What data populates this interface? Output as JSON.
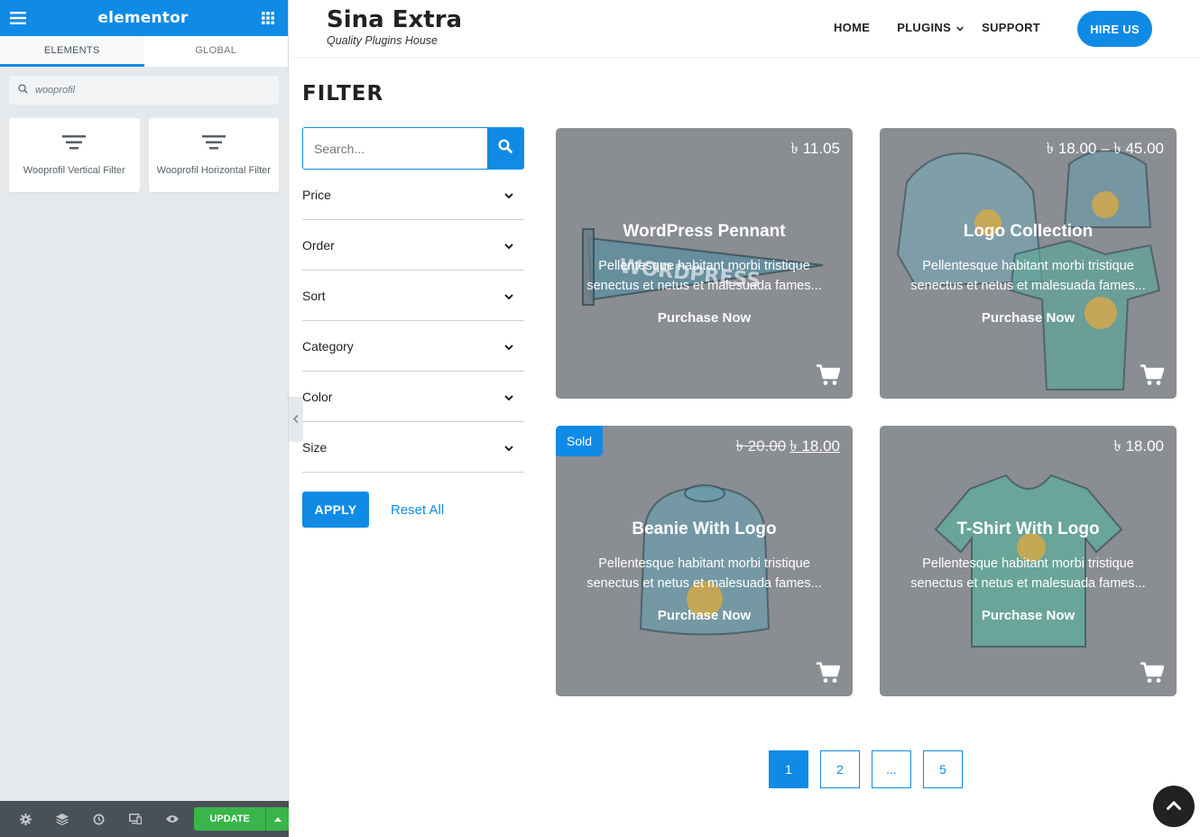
{
  "colors": {
    "accent": "#0f8be6",
    "update_green": "#39b54a",
    "card_bg": "#8a8d91",
    "sidebar_bg": "#e6e9ec"
  },
  "elementor": {
    "brand": "elementor",
    "tabs": [
      {
        "label": "ELEMENTS"
      },
      {
        "label": "GLOBAL"
      }
    ],
    "search": {
      "value": "wooprofil"
    },
    "widgets": [
      {
        "label": "Wooprofil Vertical Filter",
        "icon": "filter-lines-icon"
      },
      {
        "label": "Wooprofil Horizontal Filter",
        "icon": "filter-lines-icon"
      }
    ],
    "footer": {
      "update_label": "UPDATE"
    }
  },
  "site": {
    "title": "Sina Extra",
    "tagline": "Quality Plugins House",
    "nav": [
      {
        "label": "HOME"
      },
      {
        "label": "PLUGINS"
      },
      {
        "label": "SUPPORT"
      }
    ],
    "hire_label": "HIRE US"
  },
  "filter": {
    "heading": "FILTER",
    "search_placeholder": "Search...",
    "facets": [
      {
        "label": "Price"
      },
      {
        "label": "Order"
      },
      {
        "label": "Sort"
      },
      {
        "label": "Category"
      },
      {
        "label": "Color"
      },
      {
        "label": "Size"
      }
    ],
    "apply_label": "APPLY",
    "reset_label": "Reset All"
  },
  "products": [
    {
      "name": "WordPress Pennant",
      "price": "৳ 11.05",
      "desc": "Pellentesque habitant morbi tristique senectus et netus et malesuada fames...",
      "cta": "Purchase Now"
    },
    {
      "name": "Logo Collection",
      "price": "৳ 18.00 – ৳ 45.00",
      "desc": "Pellentesque habitant morbi tristique senectus et netus et malesuada fames...",
      "cta": "Purchase Now"
    },
    {
      "name": "Beanie With Logo",
      "badge": "Sold",
      "old_price": "৳ 20.00",
      "price": "৳ 18.00",
      "desc": "Pellentesque habitant morbi tristique senectus et netus et malesuada fames...",
      "cta": "Purchase Now"
    },
    {
      "name": "T-Shirt With Logo",
      "price": "৳ 18.00",
      "desc": "Pellentesque habitant morbi tristique senectus et netus et malesuada fames...",
      "cta": "Purchase Now"
    }
  ],
  "pagination": [
    {
      "label": "1",
      "current": true
    },
    {
      "label": "2"
    },
    {
      "label": "..."
    },
    {
      "label": "5"
    }
  ]
}
